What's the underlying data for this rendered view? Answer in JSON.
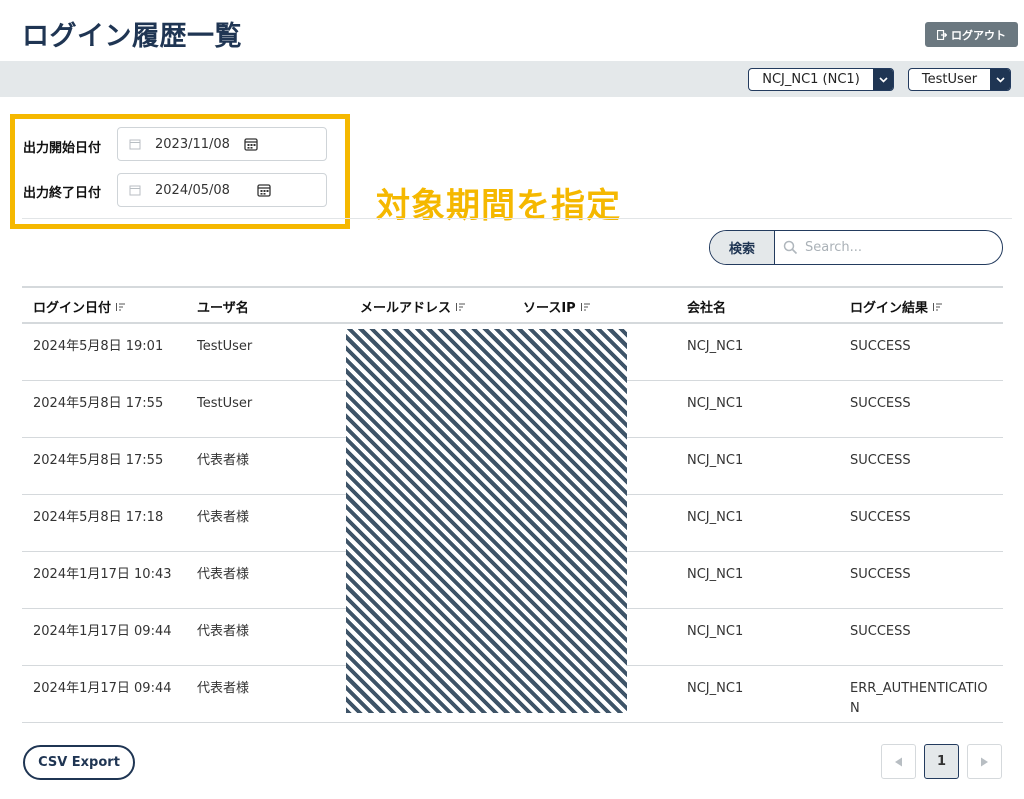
{
  "header": {
    "title": "ログイン履歴一覧",
    "logout_label": "ログアウト"
  },
  "topbar": {
    "company_select": "NCJ_NC1 (NC1)",
    "user_select": "TestUser"
  },
  "filters": {
    "start_label": "出力開始日付",
    "start_value": "2023/11/08",
    "end_label": "出力終了日付",
    "end_value": "2024/05/08"
  },
  "annotation": "対象期間を指定",
  "search": {
    "button_label": "検索",
    "placeholder": "Search..."
  },
  "table": {
    "columns": [
      "ログイン日付",
      "ユーザ名",
      "メールアドレス",
      "ソースIP",
      "会社名",
      "ログイン結果"
    ],
    "rows": [
      {
        "date": "2024年5月8日 19:01",
        "user": "TestUser",
        "company": "NCJ_NC1",
        "result": "SUCCESS"
      },
      {
        "date": "2024年5月8日 17:55",
        "user": "TestUser",
        "company": "NCJ_NC1",
        "result": "SUCCESS"
      },
      {
        "date": "2024年5月8日 17:55",
        "user": "代表者様",
        "company": "NCJ_NC1",
        "result": "SUCCESS"
      },
      {
        "date": "2024年5月8日 17:18",
        "user": "代表者様",
        "company": "NCJ_NC1",
        "result": "SUCCESS"
      },
      {
        "date": "2024年1月17日 10:43",
        "user": "代表者様",
        "company": "NCJ_NC1",
        "result": "SUCCESS"
      },
      {
        "date": "2024年1月17日 09:44",
        "user": "代表者様",
        "company": "NCJ_NC1",
        "result": "SUCCESS"
      },
      {
        "date": "2024年1月17日 09:44",
        "user": "代表者様",
        "company": "NCJ_NC1",
        "result": "ERR_AUTHENTICATION"
      }
    ]
  },
  "footer": {
    "csv_label": "CSV Export",
    "current_page": "1"
  },
  "colors": {
    "primary": "#1f3553",
    "highlight": "#f5b800",
    "topbar": "#e4e8ea",
    "logout_bg": "#6b7880"
  },
  "icons": [
    "logout-icon",
    "chevron-down-icon",
    "calendar-icon",
    "sort-icon",
    "search-icon",
    "chevron-left-icon",
    "chevron-right-icon"
  ]
}
